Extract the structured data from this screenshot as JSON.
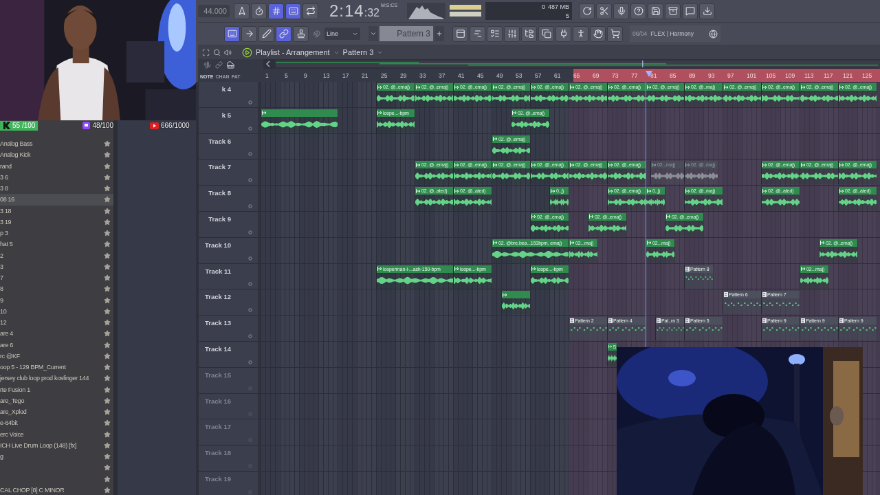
{
  "toolbar": {
    "tempo": "44.000",
    "mode_buttons": [
      {
        "on": false
      },
      {
        "on": false
      },
      {
        "on": true
      },
      {
        "on": true
      },
      {
        "on": false
      }
    ],
    "time": "2:14",
    "time_small": ":32",
    "time_unit": "M:S:CS",
    "cpu": "0",
    "memory": "487 MB",
    "polyphony": "5"
  },
  "toolbar2": {
    "tool_buttons": [
      {
        "on": true
      },
      {
        "on": false
      },
      {
        "on": false
      },
      {
        "on": true
      },
      {
        "on": false
      }
    ],
    "snap": "Line",
    "pattern": "Pattern 3",
    "hint_position": "06/04",
    "hint_text": "FLEX | Harmony"
  },
  "stream_overlay": [
    {
      "kind": "letter",
      "value": "55 /100"
    },
    {
      "kind": "chat",
      "value": "48/100"
    },
    {
      "kind": "play",
      "value": "666/1000"
    }
  ],
  "browser": {
    "items": [
      {
        "name": "Analog Bass",
        "selected": false
      },
      {
        "name": "Analog Kick",
        "selected": false
      },
      {
        "name": "rand",
        "selected": false
      },
      {
        "name": "3 6",
        "selected": false
      },
      {
        "name": "3 8",
        "selected": false
      },
      {
        "name": "08 16",
        "selected": true
      },
      {
        "name": "3 18",
        "selected": false
      },
      {
        "name": "3 19",
        "selected": false
      },
      {
        "name": "p 3",
        "selected": false
      },
      {
        "name": "hat 5",
        "selected": false
      },
      {
        "name": "2",
        "selected": false
      },
      {
        "name": "3",
        "selected": false
      },
      {
        "name": "7",
        "selected": false
      },
      {
        "name": "8",
        "selected": false
      },
      {
        "name": "9",
        "selected": false
      },
      {
        "name": "10",
        "selected": false
      },
      {
        "name": "12",
        "selected": false
      },
      {
        "name": "are 4",
        "selected": false
      },
      {
        "name": "are 6",
        "selected": false
      },
      {
        "name": "rc @KF",
        "selected": false
      },
      {
        "name": "oop 5 - 129 BPM_Current",
        "selected": false
      },
      {
        "name": "jersey club loop prod kosfinger 144",
        "selected": false
      },
      {
        "name": "rte Fusion 1",
        "selected": false
      },
      {
        "name": "are_Tego",
        "selected": false
      },
      {
        "name": "are_Xplod",
        "selected": false
      },
      {
        "name": "e-64bit",
        "selected": false
      },
      {
        "name": "erc Voice",
        "selected": false
      },
      {
        "name": "ICH Live Drum Loop (148) [fx]",
        "selected": false
      },
      {
        "name": "g",
        "selected": false
      },
      {
        "selected": false
      },
      {
        "selected": false
      },
      {
        "name": "CAL CHOP [8] C MINOR",
        "selected": false
      }
    ]
  },
  "playlist": {
    "title": "Playlist - Arrangement",
    "pattern": "Pattern 3",
    "ruler_labels": [
      "NOTE",
      "CHAN",
      "PAT"
    ],
    "ruler": [
      {
        "label": "1",
        "looped": false
      },
      {
        "label": "5",
        "looped": false
      },
      {
        "label": "9",
        "looped": false
      },
      {
        "label": "13",
        "looped": false
      },
      {
        "label": "17",
        "looped": false
      },
      {
        "label": "21",
        "looped": false
      },
      {
        "label": "25",
        "looped": false
      },
      {
        "label": "29",
        "looped": false
      },
      {
        "label": "33",
        "looped": false
      },
      {
        "label": "37",
        "looped": false
      },
      {
        "label": "41",
        "looped": false
      },
      {
        "label": "45",
        "looped": false
      },
      {
        "label": "49",
        "looped": false
      },
      {
        "label": "53",
        "looped": false
      },
      {
        "label": "57",
        "looped": false
      },
      {
        "label": "61",
        "looped": false
      },
      {
        "label": "65",
        "looped": true
      },
      {
        "label": "69",
        "looped": true
      },
      {
        "label": "73",
        "looped": true
      },
      {
        "label": "77",
        "looped": true
      },
      {
        "label": "81",
        "looped": true
      },
      {
        "label": "85",
        "looped": true
      },
      {
        "label": "89",
        "looped": true
      },
      {
        "label": "93",
        "looped": true
      },
      {
        "label": "97",
        "looped": true
      },
      {
        "label": "101",
        "looped": true
      },
      {
        "label": "105",
        "looped": true
      },
      {
        "label": "109",
        "looped": true
      },
      {
        "label": "113",
        "looped": true
      },
      {
        "label": "117",
        "looped": true
      },
      {
        "label": "121",
        "looped": true
      },
      {
        "label": "125",
        "looped": true
      }
    ],
    "tracks": [
      {
        "name": "k 4",
        "empty": false,
        "clips": [
          {
            "kind": "audio",
            "label": "02. @..emaj)"
          },
          {
            "kind": "audio",
            "label": "02. @..emaj)"
          },
          {
            "kind": "audio",
            "label": "02. @..emaj)"
          },
          {
            "kind": "audio",
            "label": "02. @..emaj)"
          },
          {
            "kind": "audio",
            "label": "02. @..emaj)"
          },
          {
            "kind": "audio",
            "label": "02. @..emaj)"
          },
          {
            "kind": "audio",
            "label": "02. @..emaj)"
          },
          {
            "kind": "audio",
            "label": "02. @..emaj)"
          },
          {
            "kind": "audio",
            "label": "02. @..maj)"
          },
          {
            "kind": "audio",
            "label": "02. @..emaj)"
          },
          {
            "kind": "audio",
            "label": "02. @..emaj)"
          },
          {
            "kind": "audio",
            "label": "02. @..emaj)"
          },
          {
            "kind": "audio",
            "label": "02. @..emaj)"
          }
        ]
      },
      {
        "name": "k 5",
        "empty": false,
        "clips": [
          {
            "kind": "audio"
          },
          {
            "kind": "audio",
            "label": "loope...-bpm"
          },
          {
            "kind": "audio",
            "label": "02. @..emaj)"
          }
        ]
      },
      {
        "name": "Track 6",
        "empty": false,
        "clips": [
          {
            "kind": "audio",
            "label": "02. @..emaj)"
          }
        ]
      },
      {
        "name": "Track 7",
        "empty": false,
        "clips": [
          {
            "kind": "audio",
            "label": "02. @..emaj)"
          },
          {
            "kind": "audio",
            "label": "02. @..emaj)"
          },
          {
            "kind": "audio",
            "label": "02. @..emaj)"
          },
          {
            "kind": "audio",
            "label": "02. @..emaj)"
          },
          {
            "kind": "audio",
            "label": "02. @..emaj)"
          },
          {
            "kind": "audio",
            "label": "02. @..emaj)"
          },
          {
            "kind": "muted",
            "label": "02...maj)"
          },
          {
            "kind": "muted",
            "label": "02. @..maj)"
          },
          {
            "kind": "audio",
            "label": "02. @..emaj)"
          },
          {
            "kind": "audio",
            "label": "02. @..emaj)"
          },
          {
            "kind": "audio",
            "label": "02. @..emaj)"
          }
        ]
      },
      {
        "name": "Track 8",
        "empty": false,
        "clips": [
          {
            "kind": "audio",
            "label": "02. @..ated)"
          },
          {
            "kind": "audio",
            "label": "02. @..ated)"
          },
          {
            "kind": "audio",
            "label": "0..j)"
          },
          {
            "kind": "audio",
            "label": "02. @..emaj)"
          },
          {
            "kind": "audio",
            "label": "0..j)"
          },
          {
            "kind": "audio",
            "label": "02. @..maj)"
          },
          {
            "kind": "audio",
            "label": "02. @..ated)"
          },
          {
            "kind": "audio",
            "label": "02. @..ated)"
          }
        ]
      },
      {
        "name": "Track 9",
        "empty": false,
        "clips": [
          {
            "kind": "audio",
            "label": "02. @..emaj)"
          },
          {
            "kind": "audio",
            "label": "02. @..emaj)"
          },
          {
            "kind": "audio",
            "label": "02. @..emaj)"
          }
        ]
      },
      {
        "name": "Track 10",
        "empty": false,
        "clips": [
          {
            "kind": "audio",
            "label": "02. @bre.bea...153bpm, emaj)"
          },
          {
            "kind": "audio",
            "label": "02...maj)"
          },
          {
            "kind": "audio",
            "label": "02...maj)"
          },
          {
            "kind": "audio",
            "label": "02. @..emaj)"
          }
        ]
      },
      {
        "name": "Track 11",
        "empty": false,
        "clips": [
          {
            "kind": "audio",
            "label": "looperman-l-...ash-150-bpm"
          },
          {
            "kind": "audio",
            "label": "loope...-bpm"
          },
          {
            "kind": "audio",
            "label": "loope...-bpm"
          },
          {
            "kind": "pattern",
            "label": "Pattern 8"
          },
          {
            "kind": "audio",
            "label": "02...maj)"
          }
        ]
      },
      {
        "name": "Track 12",
        "empty": false,
        "clips": [
          {
            "kind": "audio"
          },
          {
            "kind": "pattern",
            "label": "Pattern 6"
          },
          {
            "kind": "pattern",
            "label": "Pattern 7"
          }
        ]
      },
      {
        "name": "Track 13",
        "empty": false,
        "clips": [
          {
            "kind": "pattern",
            "label": "Pattern 2"
          },
          {
            "kind": "pattern",
            "label": "Pattern 4"
          },
          {
            "kind": "pattern",
            "label": "Pat..rn 3"
          },
          {
            "kind": "pattern",
            "label": "Pattern 5"
          },
          {
            "kind": "pattern",
            "label": "Pattern 9"
          },
          {
            "kind": "pattern",
            "label": "Pattern 9"
          },
          {
            "kind": "pattern",
            "label": "Pattern 9"
          }
        ]
      },
      {
        "name": "Track 14",
        "empty": false,
        "clips": [
          {
            "kind": "audio",
            "label": "S"
          }
        ]
      },
      {
        "name": "Track 15",
        "empty": true
      },
      {
        "name": "Track 16",
        "empty": true
      },
      {
        "name": "Track 17",
        "empty": true
      },
      {
        "name": "Track 18",
        "empty": true
      },
      {
        "name": "Track 19",
        "empty": true
      }
    ]
  }
}
